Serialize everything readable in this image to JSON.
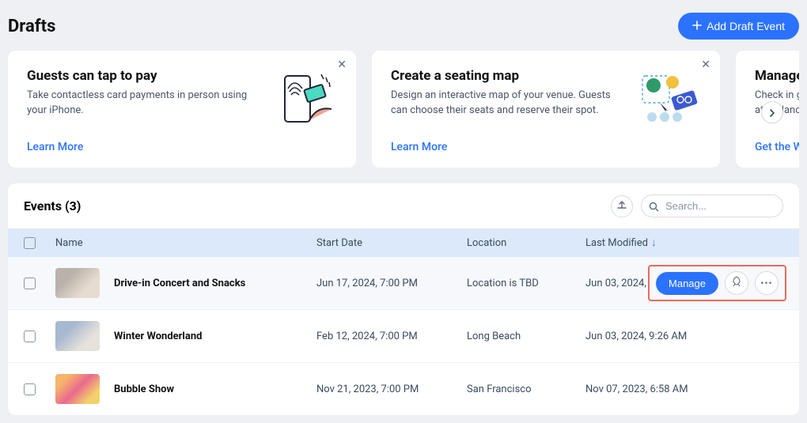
{
  "page_title": "Drafts",
  "add_button_label": "Add Draft Event",
  "cards": [
    {
      "title": "Guests can tap to pay",
      "desc": "Take contactless card payments in person using your iPhone.",
      "link": "Learn More"
    },
    {
      "title": "Create a seating map",
      "desc": "Design an interactive map of your venue. Guests can choose their seats and reserve their spot.",
      "link": "Learn More"
    },
    {
      "title": "Manage",
      "desc": "Check in guests, track attendance",
      "link": "Get the W"
    }
  ],
  "events": {
    "heading": "Events (3)",
    "search_placeholder": "Search...",
    "columns": {
      "name": "Name",
      "start": "Start Date",
      "location": "Location",
      "modified": "Last Modified"
    },
    "rows": [
      {
        "name": "Drive-in Concert and Snacks",
        "start": "Jun 17, 2024, 7:00 PM",
        "location": "Location is TBD",
        "modified": "Jun 03, 2024, 9:32 AM",
        "hovered": true
      },
      {
        "name": "Winter Wonderland",
        "start": "Feb 12, 2024, 7:00 PM",
        "location": "Long Beach",
        "modified": "Jun 03, 2024, 9:26 AM",
        "hovered": false
      },
      {
        "name": "Bubble Show",
        "start": "Nov 21, 2023, 7:00 PM",
        "location": "San Francisco",
        "modified": "Nov 07, 2023, 6:58 AM",
        "hovered": false
      }
    ],
    "manage_label": "Manage"
  }
}
